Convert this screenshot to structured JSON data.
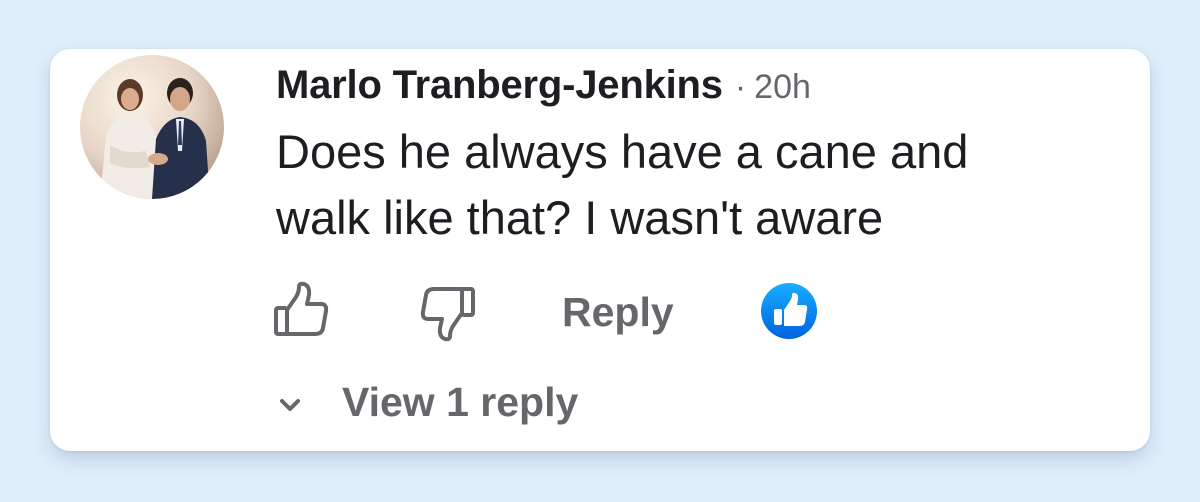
{
  "comment": {
    "author": "Marlo Tranberg-Jenkins",
    "separator": "·",
    "time": "20h",
    "text_lines": [
      "Does he always have a cane and",
      "walk like that? I wasn't aware"
    ]
  },
  "actions": {
    "like_icon": "thumbs-up-outline-icon",
    "dislike_icon": "thumbs-down-outline-icon",
    "reply_label": "Reply",
    "reaction_icon": "like-reaction-icon"
  },
  "replies": {
    "toggle_icon": "chevron-down-icon",
    "label": "View 1 reply"
  },
  "colors": {
    "background": "#dfeefb",
    "card": "#ffffff",
    "text_primary": "#1c1e21",
    "text_secondary": "#65676b",
    "like_blue": "#1877f2"
  }
}
